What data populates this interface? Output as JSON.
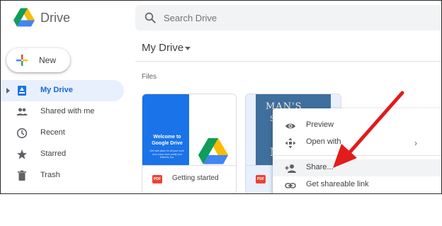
{
  "app": {
    "name": "Drive"
  },
  "search": {
    "placeholder": "Search Drive"
  },
  "new_button": {
    "label": "New"
  },
  "sidebar": {
    "items": [
      {
        "label": "My Drive",
        "icon": "my-drive-icon",
        "active": true
      },
      {
        "label": "Shared with me",
        "icon": "people-icon"
      },
      {
        "label": "Recent",
        "icon": "clock-icon"
      },
      {
        "label": "Starred",
        "icon": "star-icon"
      },
      {
        "label": "Trash",
        "icon": "trash-icon"
      }
    ]
  },
  "main": {
    "title": "My Drive",
    "section": "Files",
    "files": [
      {
        "name": "Getting started",
        "type_badge": "PDF",
        "thumb_title": "Welcome to Google Drive",
        "thumb_sub": "Get safe place for all your work. And many more pretty cool features, too."
      },
      {
        "type_badge": "PDF",
        "thumb_title_1": "MAN'S",
        "thumb_title_2": "S",
        "thumb_title_3": "MV"
      }
    ]
  },
  "context_menu": {
    "items": [
      {
        "label": "Preview",
        "icon": "eye-icon"
      },
      {
        "label": "Open with",
        "icon": "open-with-icon",
        "submenu": "›"
      },
      {
        "label": "Share...",
        "icon": "person-add-icon",
        "highlighted": true
      },
      {
        "label": "Get shareable link",
        "icon": "link-icon"
      }
    ]
  },
  "colors": {
    "accent": "#1967d2",
    "annotation_arrow": "#e21b1b",
    "active_nav_bg": "#e8f0fe"
  }
}
